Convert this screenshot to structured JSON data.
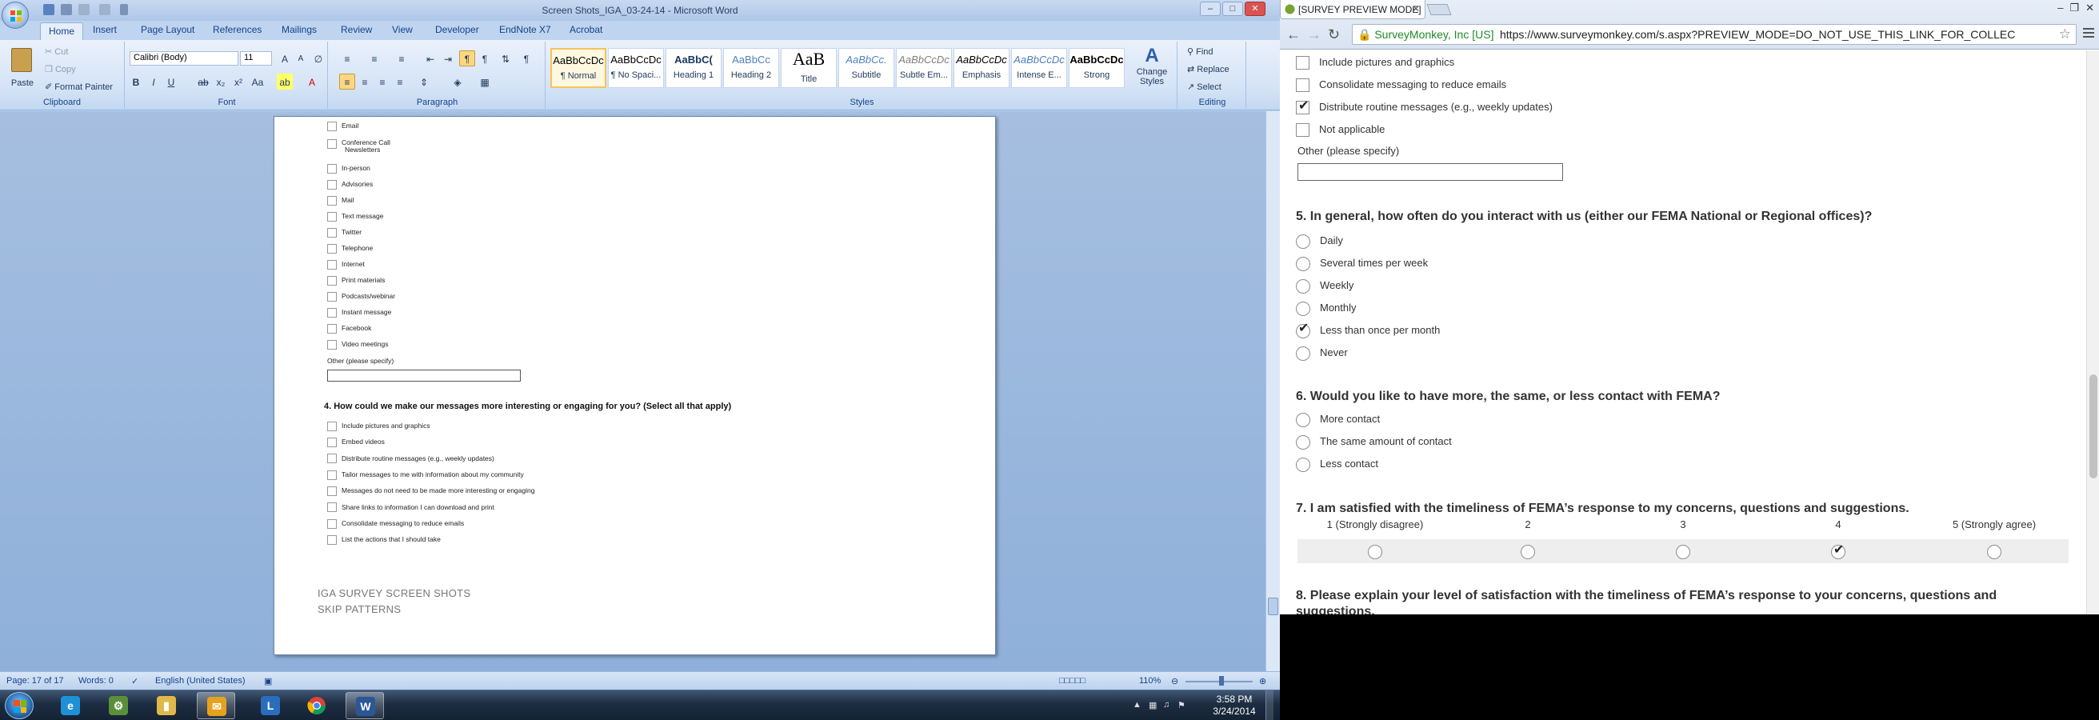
{
  "word": {
    "title": "Screen Shots_IGA_03-24-14 - Microsoft Word",
    "tabs": [
      "Home",
      "Insert",
      "Page Layout",
      "References",
      "Mailings",
      "Review",
      "View",
      "Developer",
      "EndNote X7",
      "Acrobat"
    ],
    "clipboard": {
      "paste": "Paste",
      "cut": "Cut",
      "copy": "Copy",
      "format_painter": "Format Painter",
      "label": "Clipboard"
    },
    "font": {
      "name": "Calibri (Body)",
      "size": "11",
      "label": "Font"
    },
    "paragraph": {
      "label": "Paragraph"
    },
    "styles": {
      "label": "Styles",
      "tiles": [
        {
          "preview": "AaBbCcDc",
          "name": "¶ Normal"
        },
        {
          "preview": "AaBbCcDc",
          "name": "¶ No Spaci..."
        },
        {
          "preview": "AaBbC(",
          "name": "Heading 1"
        },
        {
          "preview": "AaBbCc",
          "name": "Heading 2"
        },
        {
          "preview": "AaB",
          "name": "Title"
        },
        {
          "preview": "AaBbCc.",
          "name": "Subtitle"
        },
        {
          "preview": "AaBbCcDc",
          "name": "Subtle Em..."
        },
        {
          "preview": "AaBbCcDc",
          "name": "Emphasis"
        },
        {
          "preview": "AaBbCcDc",
          "name": "Intense E..."
        },
        {
          "preview": "AaBbCcDc",
          "name": "Strong"
        }
      ],
      "change_styles": "Change Styles"
    },
    "editing": {
      "find": "Find",
      "replace": "Replace",
      "select": "Select",
      "label": "Editing"
    },
    "document": {
      "channels": [
        "Email",
        "Conference Call",
        "Newsletters",
        "In-person",
        "Advisories",
        "Mail",
        "Text message",
        "Twitter",
        "Telephone",
        "Internet",
        "Print materials",
        "Podcasts/webinar",
        "Instant message",
        "Facebook",
        "Video meetings"
      ],
      "other_label": "Other (please specify)",
      "q4_title": "4. How could we make our messages more interesting or engaging for you? (Select all that apply)",
      "q4_options": [
        "Include pictures and graphics",
        "Embed videos",
        "Distribute routine messages (e.g., weekly updates)",
        "Tailor messages to me with information about my community",
        "Messages do not need to be made more interesting or engaging",
        "Share links to information I can download and print",
        "Consolidate messaging to reduce emails",
        "List the actions that I should take"
      ],
      "footer_line1": "IGA SURVEY SCREEN SHOTS",
      "footer_line2": "SKIP PATTERNS"
    },
    "status": {
      "page": "Page: 17 of 17",
      "words": "Words: 0",
      "language": "English (United States)",
      "zoom": "110%"
    }
  },
  "chrome": {
    "tab_title": "[SURVEY PREVIEW MODE]",
    "ev_label": "SurveyMonkey, Inc [US]",
    "url": "https://www.surveymonkey.com/s.aspx?PREVIEW_MODE=DO_NOT_USE_THIS_LINK_FOR_COLLEC",
    "q4_options": [
      {
        "label": "Include pictures and graphics",
        "checked": false
      },
      {
        "label": "Consolidate messaging to reduce emails",
        "checked": false
      },
      {
        "label": "Distribute routine messages (e.g., weekly updates)",
        "checked": true
      },
      {
        "label": "Not applicable",
        "checked": false
      }
    ],
    "other_label": "Other (please specify)",
    "q5": {
      "title": "5. In general, how often do you interact with us (either our FEMA National or Regional offices)?",
      "options": [
        {
          "label": "Daily",
          "checked": false
        },
        {
          "label": "Several times per week",
          "checked": false
        },
        {
          "label": "Weekly",
          "checked": false
        },
        {
          "label": "Monthly",
          "checked": false
        },
        {
          "label": "Less than once per month",
          "checked": true
        },
        {
          "label": "Never",
          "checked": false
        }
      ]
    },
    "q6": {
      "title": "6. Would you like to have more, the same, or less contact with FEMA?",
      "options": [
        {
          "label": "More contact",
          "checked": false
        },
        {
          "label": "The same amount of contact",
          "checked": false
        },
        {
          "label": "Less contact",
          "checked": false
        }
      ]
    },
    "q7": {
      "title": "7. I am satisfied with the timeliness of FEMA’s response to my concerns, questions and suggestions.",
      "scale": [
        {
          "label": "1 (Strongly disagree)",
          "checked": false
        },
        {
          "label": "2",
          "checked": false
        },
        {
          "label": "3",
          "checked": false
        },
        {
          "label": "4",
          "checked": true
        },
        {
          "label": "5 (Strongly agree)",
          "checked": false
        }
      ]
    },
    "q8": {
      "title_line1": "8. Please explain your level of satisfaction with the timeliness of FEMA’s response to your concerns, questions and",
      "title_line2": "suggestions."
    }
  },
  "taskbar": {
    "time": "3:58 PM",
    "date": "3/24/2014",
    "apps": [
      "start-button",
      "internet-explorer-icon",
      "control-panel-icon",
      "file-explorer-icon",
      "outlook-icon",
      "lync-icon",
      "chrome-icon",
      "word-icon"
    ]
  }
}
